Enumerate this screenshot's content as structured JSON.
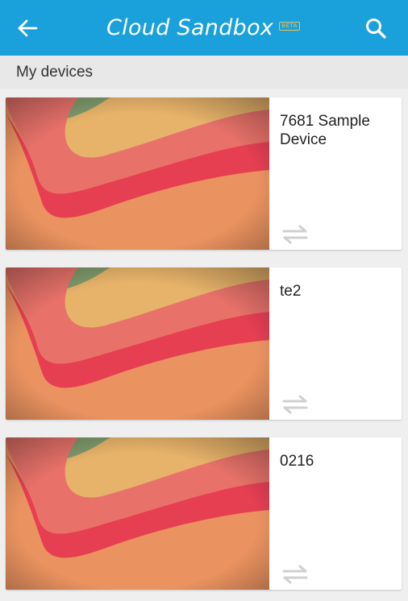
{
  "app_bar": {
    "title": "Cloud Sandbox",
    "badge": "BETA",
    "icons": {
      "back": "arrow-left-icon",
      "search": "search-icon"
    }
  },
  "section": {
    "title": "My devices"
  },
  "devices": [
    {
      "name": "7681 Sample Device",
      "action_icon": "swap-arrows-icon"
    },
    {
      "name": "te2",
      "action_icon": "swap-arrows-icon"
    },
    {
      "name": "0216",
      "action_icon": "swap-arrows-icon"
    }
  ],
  "colors": {
    "app_bar": "#1aa0db",
    "badge": "#f0c34a",
    "background": "#efefef",
    "section_header": "#e8e8e8"
  }
}
